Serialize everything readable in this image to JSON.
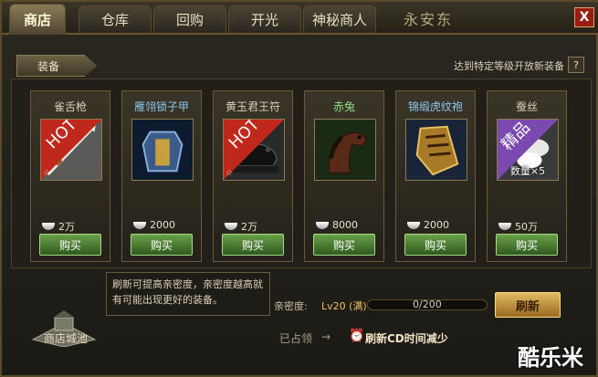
{
  "tabs": [
    {
      "label": "商店",
      "active": true
    },
    {
      "label": "仓库",
      "active": false
    },
    {
      "label": "回购",
      "active": false
    },
    {
      "label": "开光",
      "active": false
    },
    {
      "label": "神秘商人",
      "active": false
    }
  ],
  "window": {
    "brand": "永安东",
    "close_label": "X"
  },
  "category": {
    "label": "装备"
  },
  "notice": "达到特定等级开放新装备",
  "help_label": "?",
  "items": [
    {
      "name": "雀舌枪",
      "price": "2万",
      "badge": "HOT",
      "buy_label": "购买",
      "icon": "spear-icon",
      "name_color": "#f0e4c4"
    },
    {
      "name": "雁翎锁子甲",
      "price": "2000",
      "badge": "",
      "buy_label": "购买",
      "icon": "chainmail-armor-icon",
      "name_color": "#8ec8f0"
    },
    {
      "name": "黄玉君王符",
      "price": "2万",
      "badge": "HOT",
      "buy_label": "购买",
      "icon": "jade-tiger-tally-icon",
      "name_color": "#f0e4c4"
    },
    {
      "name": "赤兔",
      "price": "8000",
      "badge": "",
      "buy_label": "购买",
      "icon": "red-hare-horse-icon",
      "name_color": "#8ee08e"
    },
    {
      "name": "锦缎虎纹袍",
      "price": "2000",
      "badge": "",
      "buy_label": "购买",
      "icon": "tiger-pattern-robe-icon",
      "name_color": "#8ec8f0"
    },
    {
      "name": "蚕丝",
      "price": "50万",
      "badge": "精品",
      "quantity": "数量×5",
      "buy_label": "购买",
      "icon": "silk-cocoon-icon",
      "name_color": "#f0e4c4"
    }
  ],
  "footer": {
    "tooltip": "刷新可提高亲密度，亲密度越高就有可能出现更好的装备。",
    "city_label": "商店城池",
    "intimacy_label": "亲密度:",
    "intimacy_level": "Lv20 (满)",
    "progress_text": "0/200",
    "progress_fraction": 0,
    "refresh_label": "刷新",
    "occupied_label": "已占领",
    "arrow": "→",
    "cd_text": "刷新CD时间减少"
  },
  "watermark": "酷乐米",
  "colors": {
    "buy_green": "#4a8a30",
    "refresh_gold": "#d4a040",
    "close_red": "#9b1d12",
    "hot_red": "#c0281c",
    "premium_purple": "#7a4ab0"
  }
}
